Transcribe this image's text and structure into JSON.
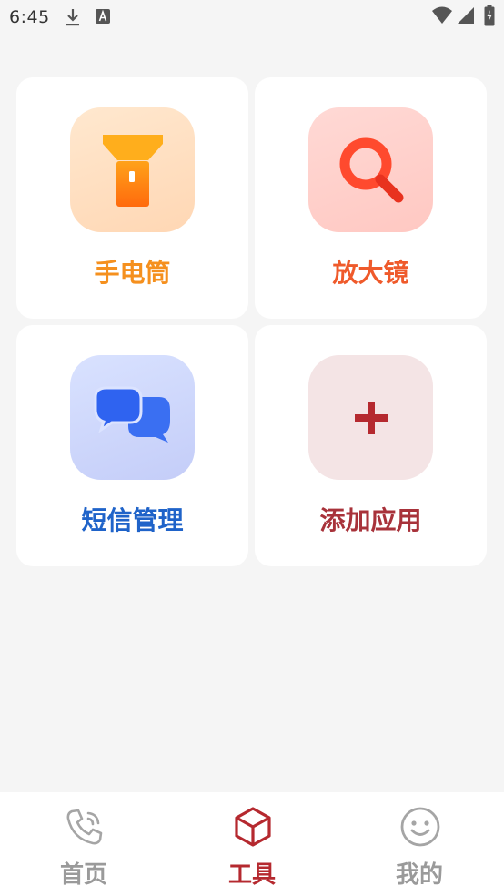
{
  "status_bar": {
    "time": "6:45",
    "icons": [
      "download-icon",
      "a-badge-icon",
      "wifi-icon",
      "signal-icon",
      "battery-charging-icon"
    ]
  },
  "tools": [
    {
      "label": "手电筒",
      "icon": "flashlight-icon",
      "label_color": "#f5901e",
      "tile_color": "#ffe2c4"
    },
    {
      "label": "放大镜",
      "icon": "magnifier-icon",
      "label_color": "#ef5a2b",
      "tile_color": "#ffd2ce"
    },
    {
      "label": "短信管理",
      "icon": "chat-bubbles-icon",
      "label_color": "#1f63c9",
      "tile_color": "#cdd6fb"
    },
    {
      "label": "添加应用",
      "icon": "plus-icon",
      "label_color": "#a8323a",
      "tile_color": "#f5e3e3"
    }
  ],
  "bottom_nav": {
    "items": [
      {
        "label": "首页",
        "icon": "phone-icon",
        "active": false
      },
      {
        "label": "工具",
        "icon": "cube-icon",
        "active": true
      },
      {
        "label": "我的",
        "icon": "smiley-icon",
        "active": false
      }
    ],
    "active_color": "#b5292f",
    "inactive_color": "#9a9a9a"
  }
}
